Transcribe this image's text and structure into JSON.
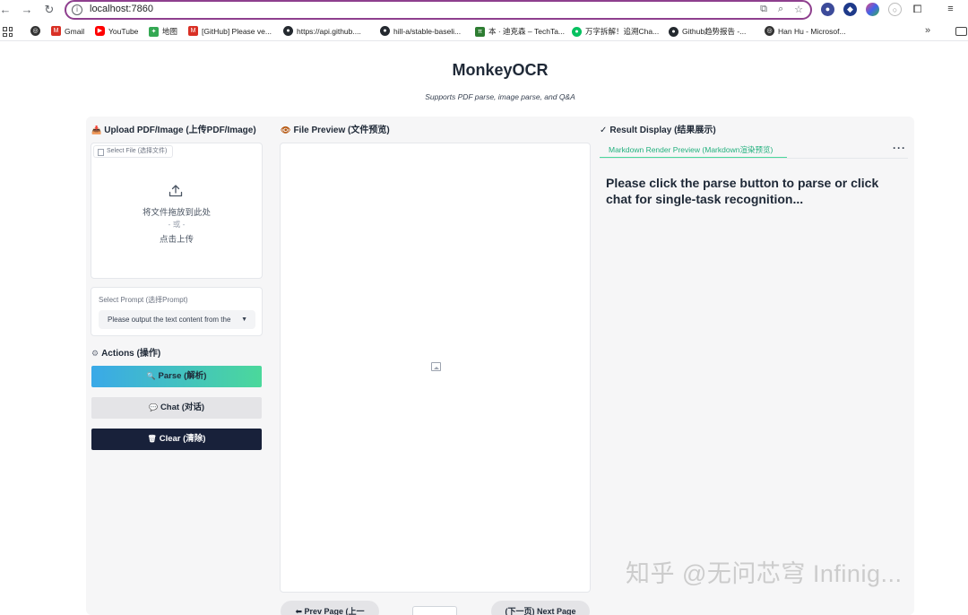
{
  "browser": {
    "url": "localhost:7860",
    "bookmarks": [
      {
        "label": "",
        "icon": "globe-icon",
        "color": "#333333"
      },
      {
        "label": "Gmail",
        "icon": "gmail-icon",
        "color": "#d93025"
      },
      {
        "label": "YouTube",
        "icon": "youtube-icon",
        "color": "#ff0000"
      },
      {
        "label": "地图",
        "icon": "maps-icon",
        "color": "#34a853"
      },
      {
        "label": "[GitHub] Please ve...",
        "icon": "gmail-icon",
        "color": "#d93025"
      },
      {
        "label": "https://api.github....",
        "icon": "github-icon",
        "color": "#24292f"
      },
      {
        "label": "hill-a/stable-baseli...",
        "icon": "github-icon",
        "color": "#24292f"
      },
      {
        "label": "本 · 迪克森 – TechTa...",
        "icon": "techtarget-icon",
        "color": "#2e7d32"
      },
      {
        "label": "万字拆解！追溯Cha...",
        "icon": "wechat-icon",
        "color": "#07c160"
      },
      {
        "label": "Github趋势报告 -...",
        "icon": "github-icon",
        "color": "#24292f"
      },
      {
        "label": "Han Hu - Microsof...",
        "icon": "globe-icon",
        "color": "#333333"
      }
    ],
    "more": "»"
  },
  "app": {
    "title": "MonkeyOCR",
    "subtitle": "Supports PDF parse, image parse, and Q&A"
  },
  "upload": {
    "label": "Upload PDF/Image (上传PDF/Image)",
    "file_tag": "Select File (选择文件)",
    "drop_text": "将文件拖放到此处",
    "or_text": "- 或 -",
    "click_text": "点击上传"
  },
  "prompt": {
    "label": "Select Prompt (选择Prompt)",
    "value": "Please output the text content from the"
  },
  "actions": {
    "label": "Actions (操作)",
    "parse": "Parse (解析)",
    "chat": "Chat (对话)",
    "clear": "Clear (清除)"
  },
  "preview": {
    "label": "File Preview (文件预览)",
    "prev": "Prev Page (上一",
    "next": "(下一页) Next Page"
  },
  "result": {
    "label": "Result Display (结果展示)",
    "tab": "Markdown Render Preview (Markdown渲染预览)",
    "message": "Please click the parse button to parse or click chat for single-task recognition..."
  },
  "watermark": "知乎 @无问芯穹 Infinig..."
}
